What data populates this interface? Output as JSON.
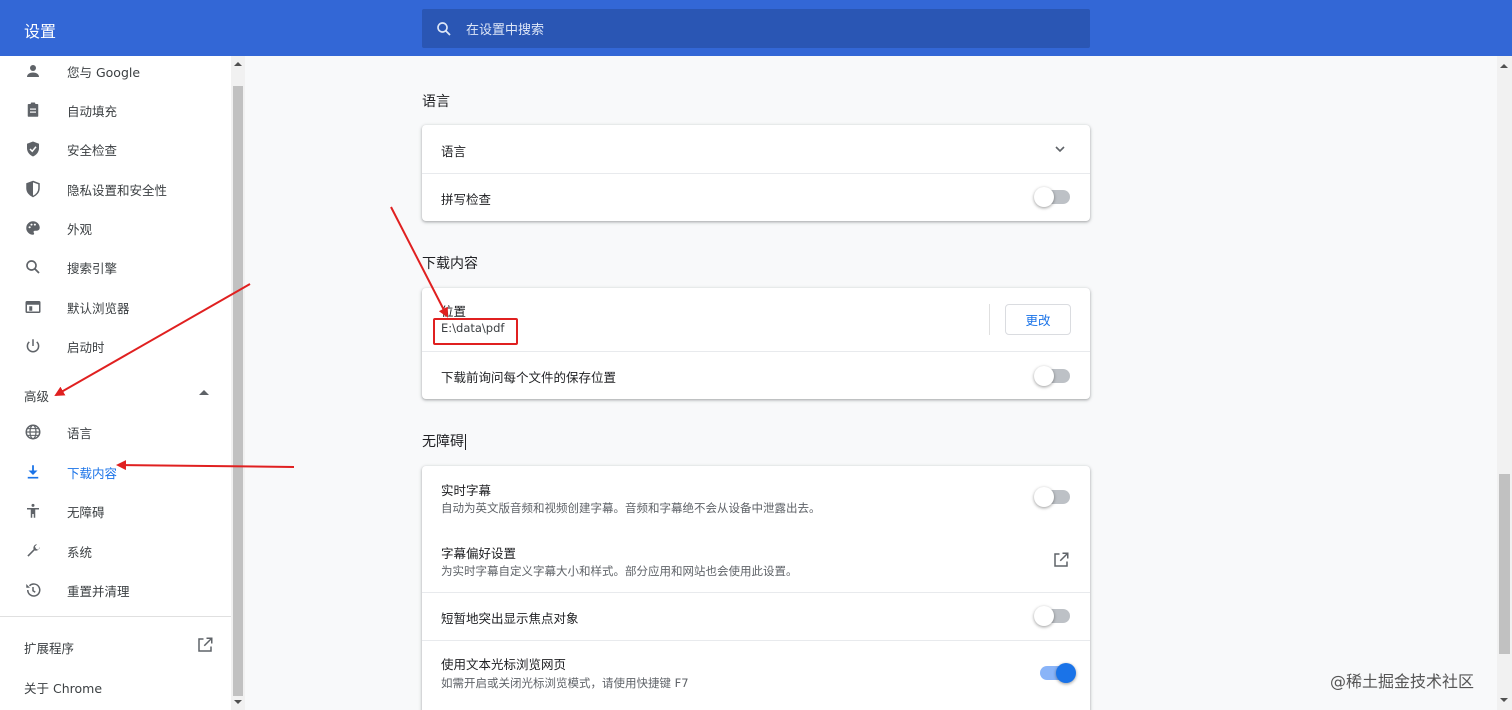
{
  "header": {
    "title": "设置",
    "search_placeholder": "在设置中搜索"
  },
  "sidebar": {
    "items": [
      {
        "label": "您与 Google",
        "icon": "person-icon"
      },
      {
        "label": "自动填充",
        "icon": "clipboard-icon"
      },
      {
        "label": "安全检查",
        "icon": "shield-check-icon"
      },
      {
        "label": "隐私设置和安全性",
        "icon": "shield-half-icon"
      },
      {
        "label": "外观",
        "icon": "palette-icon"
      },
      {
        "label": "搜索引擎",
        "icon": "search-icon"
      },
      {
        "label": "默认浏览器",
        "icon": "browser-window-icon"
      },
      {
        "label": "启动时",
        "icon": "power-icon"
      }
    ],
    "advanced_label": "高级",
    "advanced_items": [
      {
        "label": "语言",
        "icon": "globe-icon"
      },
      {
        "label": "下载内容",
        "icon": "download-icon",
        "active": true
      },
      {
        "label": "无障碍",
        "icon": "accessibility-icon"
      },
      {
        "label": "系统",
        "icon": "wrench-icon"
      },
      {
        "label": "重置并清理",
        "icon": "history-icon"
      }
    ],
    "extensions_label": "扩展程序",
    "about_label": "关于 Chrome"
  },
  "main": {
    "language_section": {
      "title": "语言",
      "rows": [
        {
          "label": "语言"
        },
        {
          "label": "拼写检查",
          "toggle": false
        }
      ]
    },
    "downloads_section": {
      "title": "下载内容",
      "location_label": "位置",
      "location_value": "E:\\data\\pdf",
      "change_button": "更改",
      "ask_label": "下载前询问每个文件的保存位置",
      "ask_toggle": false
    },
    "accessibility_section": {
      "title": "无障碍",
      "rows": [
        {
          "label": "实时字幕",
          "sub": "自动为英文版音频和视频创建字幕。音频和字幕绝不会从设备中泄露出去。",
          "toggle": false
        },
        {
          "label": "字幕偏好设置",
          "sub": "为实时字幕自定义字幕大小和样式。部分应用和网站也会使用此设置。"
        },
        {
          "label": "短暂地突出显示焦点对象",
          "toggle": false
        },
        {
          "label": "使用文本光标浏览网页",
          "sub": "如需开启或关闭光标浏览模式，请使用快捷键 F7",
          "toggle": true
        }
      ]
    }
  },
  "watermark": "@稀土掘金技术社区",
  "colors": {
    "header_bg": "#3367d6",
    "accent": "#1a73e8",
    "annotation": "#e02020"
  }
}
